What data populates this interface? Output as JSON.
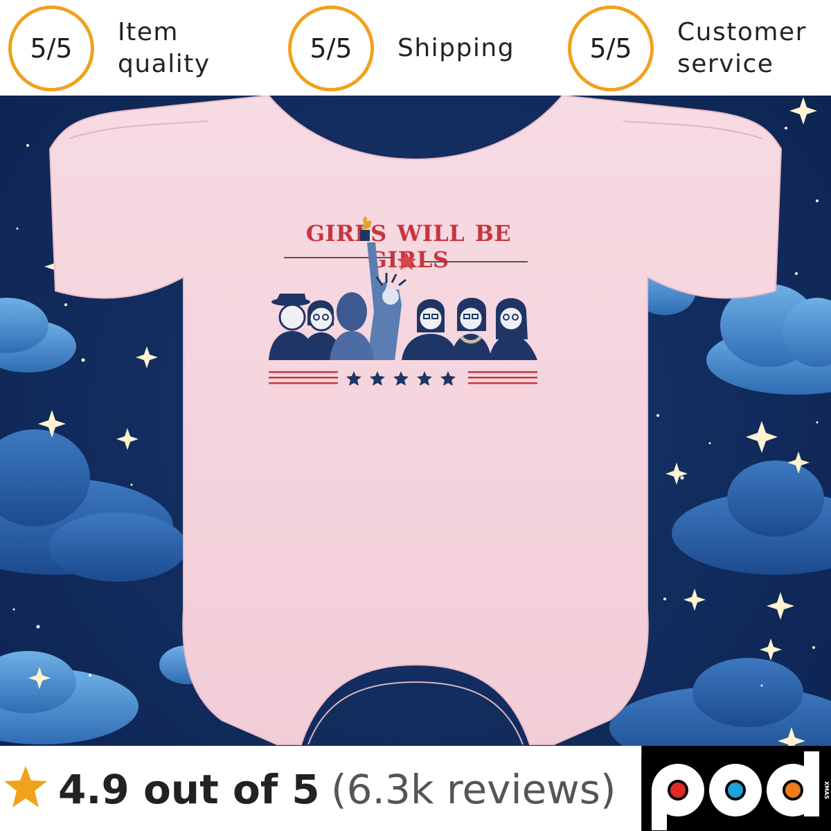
{
  "ratings": [
    {
      "score": "5/5",
      "label_line1": "Item",
      "label_line2": "quality"
    },
    {
      "score": "5/5",
      "label_line1": "Shipping",
      "label_line2": ""
    },
    {
      "score": "5/5",
      "label_line1": "Customer",
      "label_line2": "service"
    }
  ],
  "product": {
    "design_text": "GIRLS WILL BE GIRLS",
    "garment_color": "#f6d8e0",
    "print_red": "#c8353f",
    "print_navy": "#1f3566"
  },
  "reviews": {
    "score_text": "4.9 out of 5",
    "count_text": "(6.3k reviews)",
    "star_icon": "star-icon",
    "star_color": "#f0a21d"
  },
  "brand": {
    "logo_text": "pod",
    "logo_subtext": "XMAS"
  },
  "colors": {
    "accent": "#f0a21d",
    "night_sky": "#0f2a57",
    "cloud": "#3f83c9"
  }
}
